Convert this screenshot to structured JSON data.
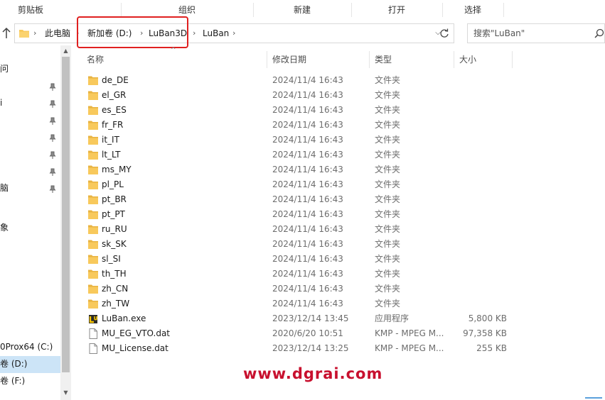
{
  "ribbon": {
    "groups": [
      "剪贴板",
      "组织",
      "新建",
      "打开",
      "选择"
    ]
  },
  "address": {
    "crumbs": [
      "此电脑",
      "新加卷 (D:)",
      "LuBan3D",
      "LuBan"
    ]
  },
  "search": {
    "placeholder": "搜索\"LuBan\""
  },
  "sidebar": {
    "items": [
      {
        "label": "问",
        "pinned": false
      },
      {
        "label": "i",
        "pinned": true
      },
      {
        "label": "",
        "pinned": true
      },
      {
        "label": "",
        "pinned": true
      },
      {
        "label": "",
        "pinned": true
      },
      {
        "label": "",
        "pinned": true
      },
      {
        "label": "脑",
        "pinned": true
      },
      {
        "label": "象",
        "pinned": false
      }
    ],
    "drives": [
      "0Prox64 (C:)",
      "卷 (D:)",
      "卷 (F:)"
    ],
    "selected_drive": "卷 (D:)"
  },
  "columns": {
    "name": "名称",
    "date": "修改日期",
    "type": "类型",
    "size": "大小"
  },
  "files": [
    {
      "name": "de_DE",
      "date": "2024/11/4 16:43",
      "type": "文件夹",
      "size": "",
      "icon": "folder-icon"
    },
    {
      "name": "el_GR",
      "date": "2024/11/4 16:43",
      "type": "文件夹",
      "size": "",
      "icon": "folder-icon"
    },
    {
      "name": "es_ES",
      "date": "2024/11/4 16:43",
      "type": "文件夹",
      "size": "",
      "icon": "folder-icon"
    },
    {
      "name": "fr_FR",
      "date": "2024/11/4 16:43",
      "type": "文件夹",
      "size": "",
      "icon": "folder-icon"
    },
    {
      "name": "it_IT",
      "date": "2024/11/4 16:43",
      "type": "文件夹",
      "size": "",
      "icon": "folder-icon"
    },
    {
      "name": "lt_LT",
      "date": "2024/11/4 16:43",
      "type": "文件夹",
      "size": "",
      "icon": "folder-icon"
    },
    {
      "name": "ms_MY",
      "date": "2024/11/4 16:43",
      "type": "文件夹",
      "size": "",
      "icon": "folder-icon"
    },
    {
      "name": "pl_PL",
      "date": "2024/11/4 16:43",
      "type": "文件夹",
      "size": "",
      "icon": "folder-icon"
    },
    {
      "name": "pt_BR",
      "date": "2024/11/4 16:43",
      "type": "文件夹",
      "size": "",
      "icon": "folder-icon"
    },
    {
      "name": "pt_PT",
      "date": "2024/11/4 16:43",
      "type": "文件夹",
      "size": "",
      "icon": "folder-icon"
    },
    {
      "name": "ru_RU",
      "date": "2024/11/4 16:43",
      "type": "文件夹",
      "size": "",
      "icon": "folder-icon"
    },
    {
      "name": "sk_SK",
      "date": "2024/11/4 16:43",
      "type": "文件夹",
      "size": "",
      "icon": "folder-icon"
    },
    {
      "name": "sl_SI",
      "date": "2024/11/4 16:43",
      "type": "文件夹",
      "size": "",
      "icon": "folder-icon"
    },
    {
      "name": "th_TH",
      "date": "2024/11/4 16:43",
      "type": "文件夹",
      "size": "",
      "icon": "folder-icon"
    },
    {
      "name": "zh_CN",
      "date": "2024/11/4 16:43",
      "type": "文件夹",
      "size": "",
      "icon": "folder-icon"
    },
    {
      "name": "zh_TW",
      "date": "2024/11/4 16:43",
      "type": "文件夹",
      "size": "",
      "icon": "folder-icon"
    },
    {
      "name": "LuBan.exe",
      "date": "2023/12/14 13:45",
      "type": "应用程序",
      "size": "5,800 KB",
      "icon": "app-icon"
    },
    {
      "name": "MU_EG_VTO.dat",
      "date": "2020/6/20 10:51",
      "type": "KMP - MPEG M...",
      "size": "97,358 KB",
      "icon": "file-icon"
    },
    {
      "name": "MU_License.dat",
      "date": "2023/12/14 13:25",
      "type": "KMP - MPEG M...",
      "size": "255 KB",
      "icon": "file-icon"
    }
  ],
  "watermark": "www.dgrai.com",
  "colors": {
    "folder": "#f8c95c",
    "highlight": "#e02020",
    "selection": "#cce4f7",
    "watermark": "#c8102e"
  }
}
